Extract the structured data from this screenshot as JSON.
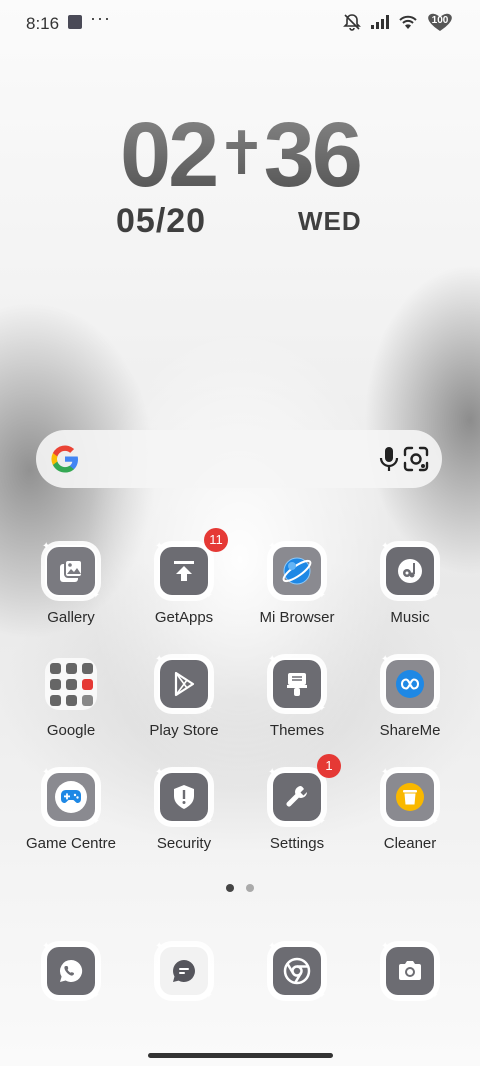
{
  "status_bar": {
    "time": "8:16",
    "battery": "100",
    "icons": [
      "notification-square-icon",
      "more-dots-icon",
      "silent-bell-icon",
      "signal-icon",
      "wifi-icon",
      "battery-icon"
    ]
  },
  "clock": {
    "hours": "02",
    "separator": "✝",
    "minutes": "36",
    "date": "05/20",
    "weekday": "WED"
  },
  "search_bar": {
    "icons": [
      "google-g-icon",
      "microphone-icon",
      "lens-icon"
    ]
  },
  "apps": [
    {
      "label": "Gallery",
      "icon": "gallery-icon",
      "badge": ""
    },
    {
      "label": "GetApps",
      "icon": "getapps-icon",
      "badge": "11"
    },
    {
      "label": "Mi Browser",
      "icon": "browser-icon",
      "badge": ""
    },
    {
      "label": "Music",
      "icon": "music-icon",
      "badge": ""
    },
    {
      "label": "Google",
      "icon": "google-folder-icon",
      "badge": ""
    },
    {
      "label": "Play Store",
      "icon": "play-store-icon",
      "badge": ""
    },
    {
      "label": "Themes",
      "icon": "themes-icon",
      "badge": ""
    },
    {
      "label": "ShareMe",
      "icon": "shareme-icon",
      "badge": ""
    },
    {
      "label": "Game Centre",
      "icon": "gamepad-icon",
      "badge": ""
    },
    {
      "label": "Security",
      "icon": "security-shield-icon",
      "badge": ""
    },
    {
      "label": "Settings",
      "icon": "settings-wrench-icon",
      "badge": "1"
    },
    {
      "label": "Cleaner",
      "icon": "cleaner-bin-icon",
      "badge": ""
    }
  ],
  "pager": {
    "pages": 2,
    "current": 1
  },
  "dock": [
    {
      "icon": "whatsapp-icon"
    },
    {
      "icon": "messages-icon"
    },
    {
      "icon": "chrome-icon"
    },
    {
      "icon": "camera-icon"
    }
  ],
  "colors": {
    "accent_blue": "#1e88e5",
    "badge_red": "#e53935",
    "icon_grey": "#6c6c72",
    "cleaner_yellow": "#f9b800"
  }
}
